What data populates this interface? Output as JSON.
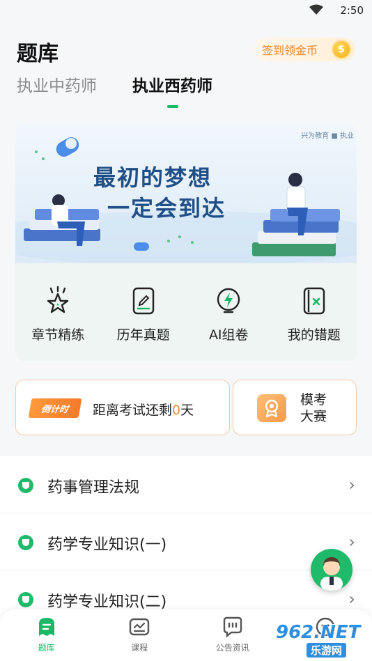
{
  "status_bar": {
    "time": "2:50"
  },
  "header": {
    "title": "题库",
    "signin_label": "签到领金币",
    "coin_symbol": "$",
    "tabs": [
      {
        "label": "执业中药师",
        "active": false
      },
      {
        "label": "执业西药师",
        "active": true
      }
    ]
  },
  "banner": {
    "line1": "最初的梦想",
    "line2": "一定会到达",
    "brand": "兴为教育 ■ 执业"
  },
  "features": [
    {
      "label": "章节精练",
      "icon": "chapter-star-icon"
    },
    {
      "label": "历年真题",
      "icon": "past-papers-icon"
    },
    {
      "label": "AI组卷",
      "icon": "ai-lightning-icon"
    },
    {
      "label": "我的错题",
      "icon": "wrong-questions-icon"
    }
  ],
  "countdown": {
    "badge": "倒计时",
    "text_prefix": "距离考试还剩",
    "days": "0",
    "text_suffix": "天"
  },
  "mock_exam": {
    "line1": "模考",
    "line2": "大赛"
  },
  "subjects": [
    {
      "label": "药事管理法规"
    },
    {
      "label": "药学专业知识(一)"
    },
    {
      "label": "药学专业知识(二)"
    }
  ],
  "bottom_nav": [
    {
      "label": "题库",
      "active": true
    },
    {
      "label": "课程",
      "active": false
    },
    {
      "label": "公告资讯",
      "active": false
    },
    {
      "label": "",
      "active": false
    }
  ],
  "watermark": {
    "top": "962.NET",
    "bottom": "乐游网"
  },
  "colors": {
    "accent": "#19b866",
    "orange": "#f08a3a",
    "banner_text": "#1f4f86"
  }
}
